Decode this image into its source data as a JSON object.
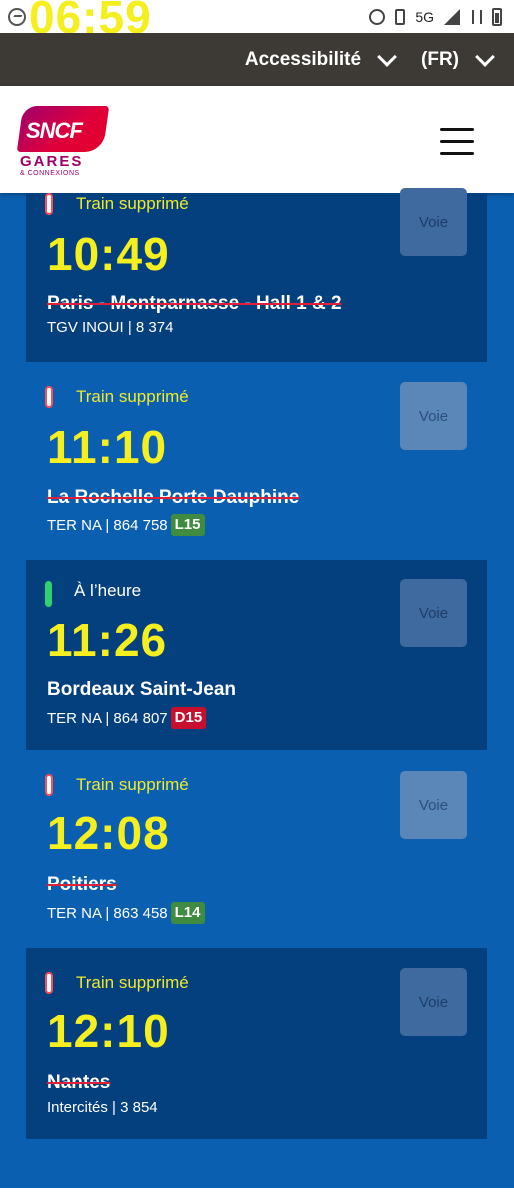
{
  "statusbar": {
    "time": "06:59",
    "network": "5G"
  },
  "topbar": {
    "accessibility": "Accessibilité",
    "language": "(FR)"
  },
  "header": {
    "logo_text": "SNCF",
    "logo_sub1": "GARES",
    "logo_sub2": "& CONNEXIONS"
  },
  "trains": [
    {
      "status": "Train supprimé",
      "status_type": "cancelled",
      "time": "10:49",
      "destination": "Paris - Montparnasse - Hall 1 & 2",
      "info": "TGV INOUI | 8 374",
      "badge": "",
      "badge_color": "",
      "voie": "Voie"
    },
    {
      "status": "Train supprimé",
      "status_type": "cancelled",
      "time": "11:10",
      "destination": "La Rochelle Porte Dauphine",
      "info": "TER NA | 864 758",
      "badge": "L15",
      "badge_color": "#3f8b3f",
      "voie": "Voie"
    },
    {
      "status": "À l’heure",
      "status_type": "on-time",
      "time": "11:26",
      "destination": "Bordeaux Saint-Jean",
      "info": "TER NA | 864 807",
      "badge": "D15",
      "badge_color": "#c8102e",
      "voie": "Voie"
    },
    {
      "status": "Train supprimé",
      "status_type": "cancelled",
      "time": "12:08",
      "destination": "Poitiers",
      "info": "TER NA | 863 458",
      "badge": "L14",
      "badge_color": "#3f8b3f",
      "voie": "Voie"
    },
    {
      "status": "Train supprimé",
      "status_type": "cancelled",
      "time": "12:10",
      "destination": "Nantes",
      "info": "Intercités | 3 854",
      "badge": "",
      "badge_color": "",
      "voie": "Voie"
    }
  ],
  "colors": {
    "page_bg": "#0a5fb0",
    "card_bg": "#04407d",
    "time_yellow": "#f6ef1f",
    "status_yellow": "#f0e92c",
    "cancel_red": "#e0203a",
    "ok_green": "#2dd36f"
  }
}
